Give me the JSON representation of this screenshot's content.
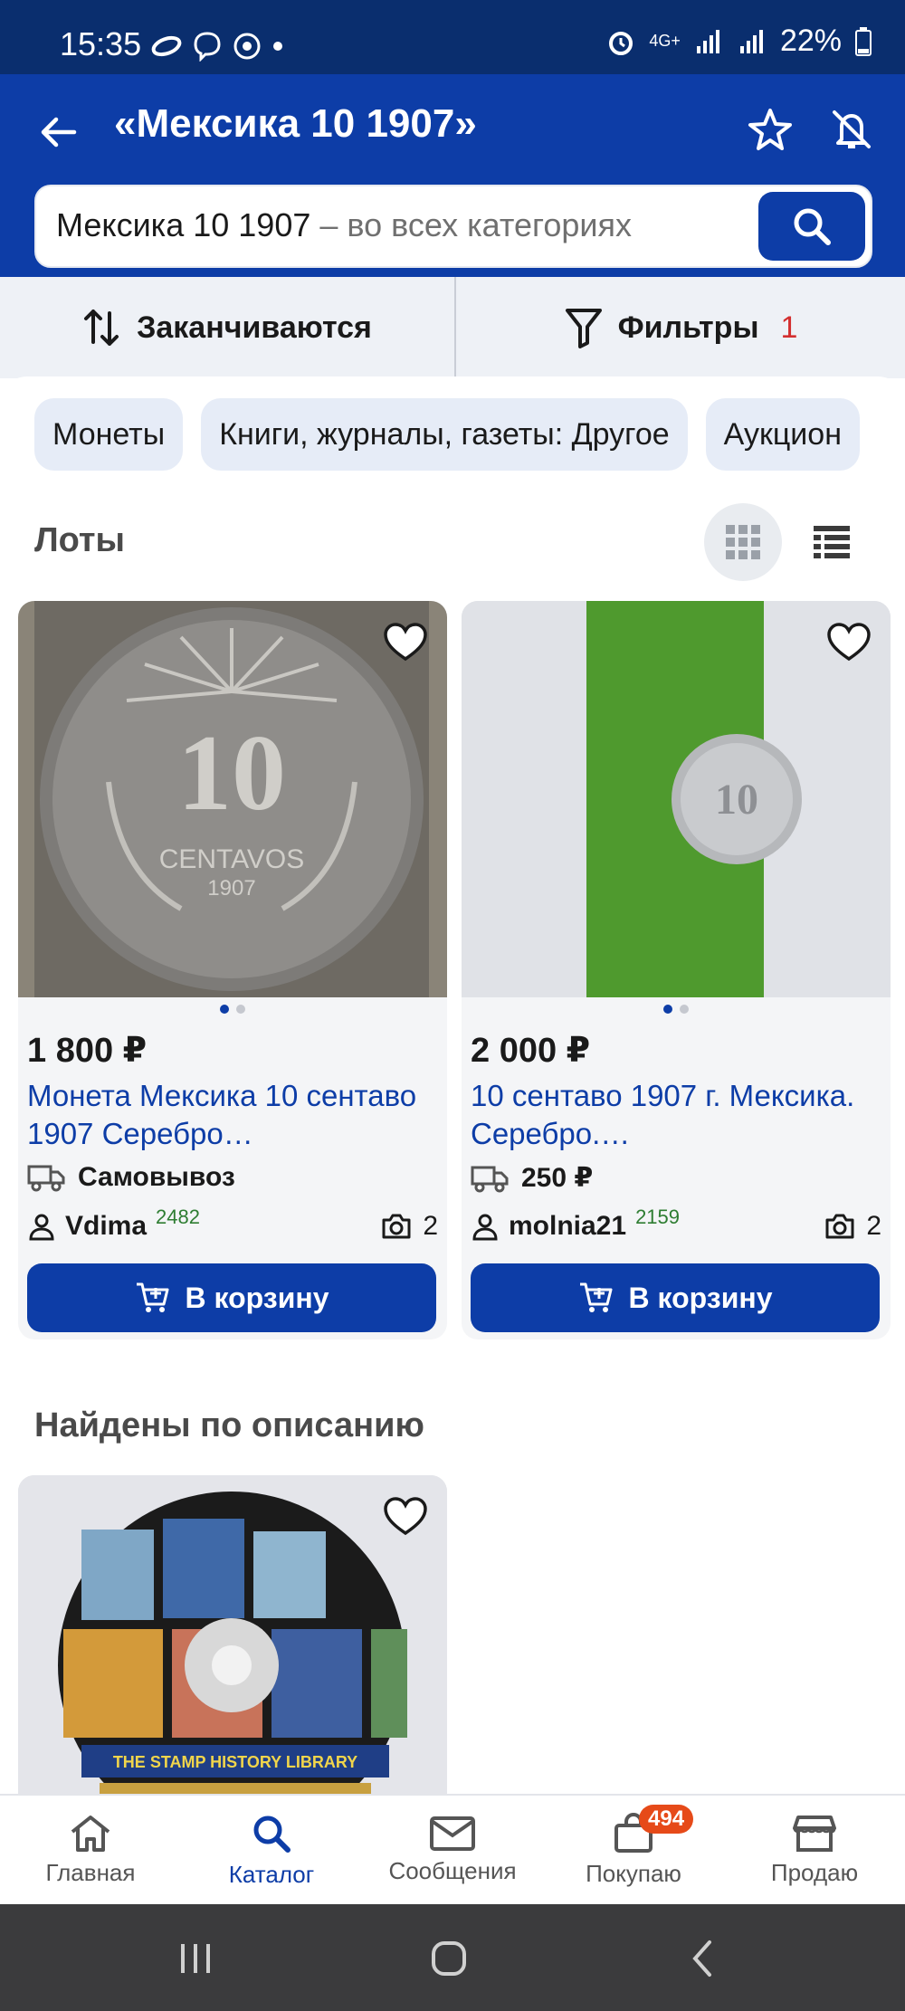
{
  "status_bar": {
    "time": "15:35",
    "network": "4G+",
    "battery": "22%"
  },
  "header": {
    "title": "«Мексика 10 1907»"
  },
  "search": {
    "query": "Мексика 10 1907",
    "scope": " – во всех категориях"
  },
  "sort_filter": {
    "sort_label": "Заканчиваются",
    "filter_label": "Фильтры",
    "filter_count": "1"
  },
  "chips": [
    "Монеты",
    "Книги, журналы, газеты: Другое",
    "Аукцион"
  ],
  "lots_section": {
    "title": "Лоты"
  },
  "lots": [
    {
      "price": "1 800 ₽",
      "title": "Монета Мексика 10 сентаво 1907 Серебро…",
      "delivery": "Самовывоз",
      "seller": "Vdima",
      "rating": "2482",
      "photos": "2",
      "cart_label": "В корзину",
      "coin_value": "10",
      "coin_text": "CENTAVOS",
      "coin_year": "1907"
    },
    {
      "price": "2 000 ₽",
      "title": "10 сентаво 1907 г. Мексика. Серебро.…",
      "delivery": "250 ₽",
      "seller": "molnia21",
      "rating": "2159",
      "photos": "2",
      "cart_label": "В корзину",
      "coin_value": "10"
    }
  ],
  "description_section": {
    "title": "Найдены по описанию"
  },
  "description_lot": {
    "disc_caption": "THE STAMP HISTORY LIBRARY"
  },
  "bottom_nav": [
    {
      "label": "Главная",
      "icon": "home-icon"
    },
    {
      "label": "Каталог",
      "icon": "search-icon"
    },
    {
      "label": "Сообщения",
      "icon": "mail-icon"
    },
    {
      "label": "Покупаю",
      "icon": "bag-icon",
      "badge": "494"
    },
    {
      "label": "Продаю",
      "icon": "store-icon"
    }
  ],
  "colors": {
    "primary": "#0d3da7",
    "status_bar": "#0a2e6e",
    "accent_red": "#d32f2f",
    "rating_green": "#2e7d32",
    "badge": "#e64a19"
  }
}
